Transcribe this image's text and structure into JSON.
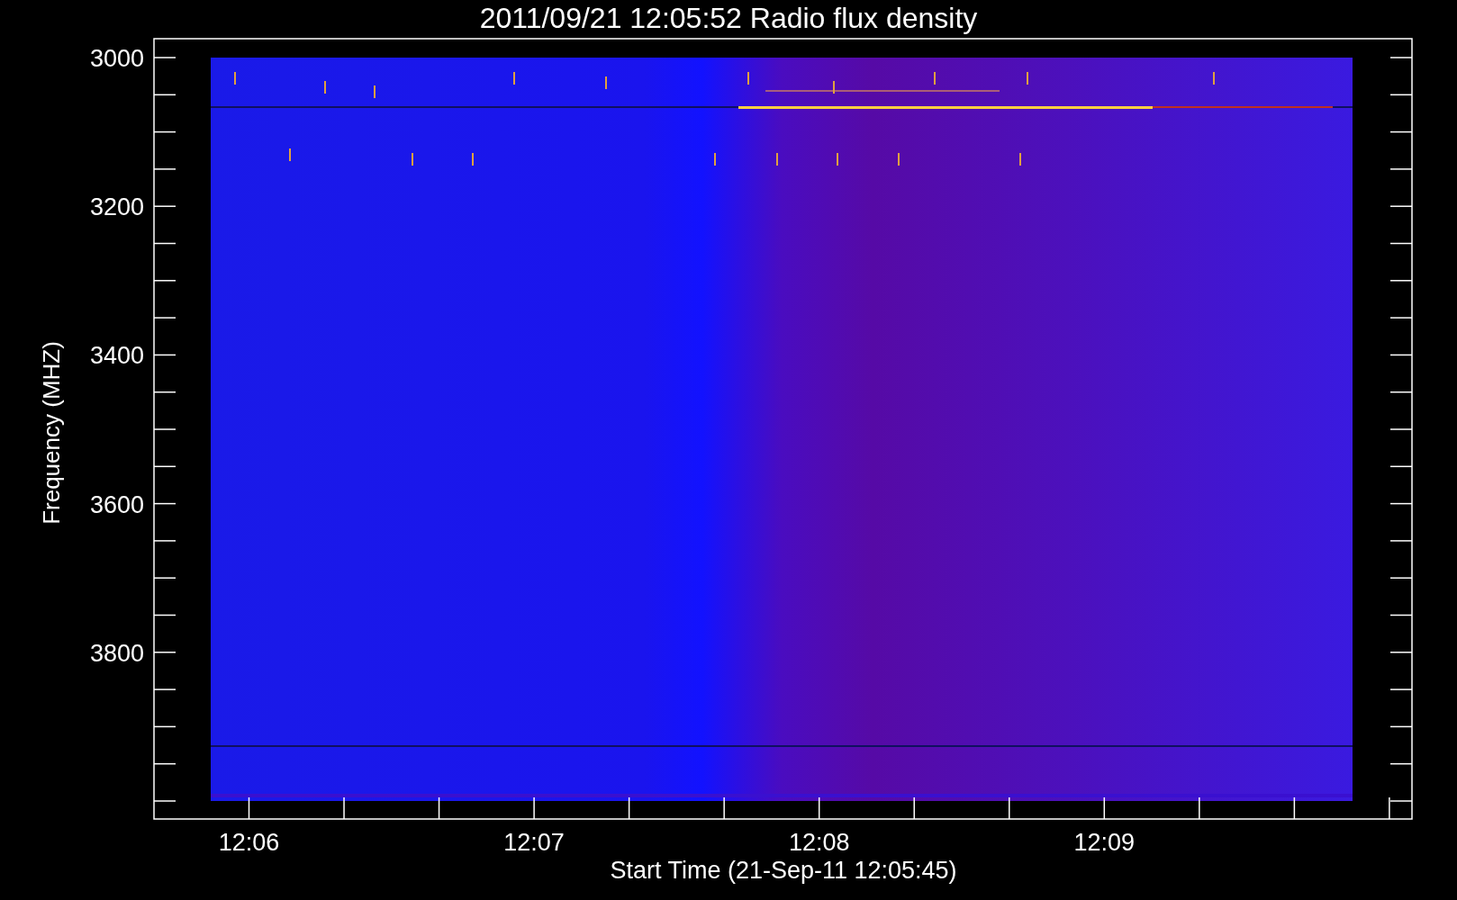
{
  "title": "2011/09/21 12:05:52 Radio flux density",
  "y_axis": {
    "label": "Frequency (MHZ)",
    "ticks": [
      "3000",
      "3200",
      "3400",
      "3600",
      "3800"
    ]
  },
  "x_axis": {
    "label": "Start Time (21-Sep-11 12:05:45)",
    "ticks": [
      "12:06",
      "12:07",
      "12:08",
      "12:09"
    ]
  }
}
